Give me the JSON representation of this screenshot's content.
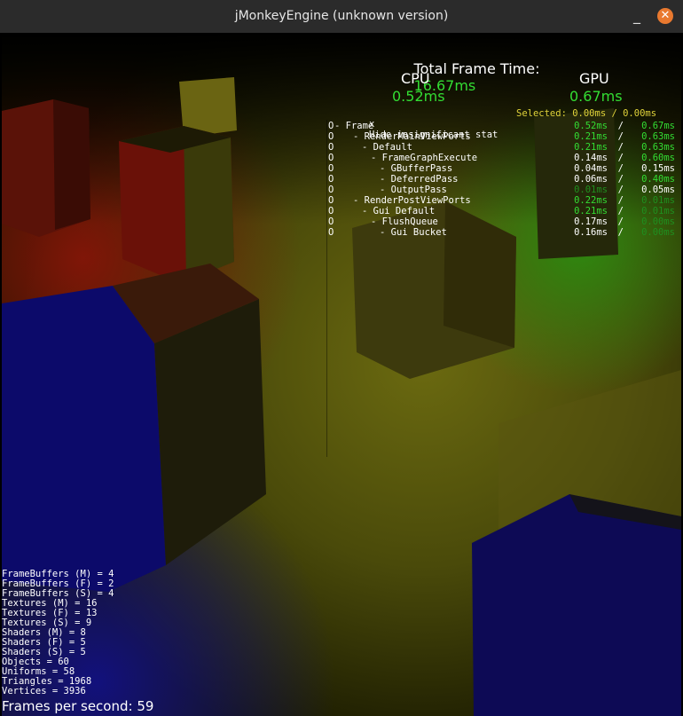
{
  "window": {
    "title": "jMonkeyEngine (unknown version)",
    "minimize_glyph": "_",
    "close_glyph": "✕"
  },
  "profiler": {
    "total_label": "Total Frame Time:",
    "total_value": "16.67ms",
    "cpu_label": "CPU",
    "cpu_value": "0.52ms",
    "gpu_label": "GPU",
    "gpu_value": "0.67ms",
    "hide_label": "Hide insignificant stat",
    "hide_glyph": "x",
    "selected_label": "Selected: 0.00ms / 0.00ms",
    "rows": [
      {
        "toggle": "O",
        "label": "- Frame",
        "cpu": "0.52ms",
        "sep": "/",
        "gpu": "0.67ms"
      },
      {
        "toggle": "O",
        "label": "- RenderMainViewPorts",
        "cpu": "0.21ms",
        "sep": "/",
        "gpu": "0.63ms"
      },
      {
        "toggle": "O",
        "label": "- Default",
        "cpu": "0.21ms",
        "sep": "/",
        "gpu": "0.63ms"
      },
      {
        "toggle": "O",
        "label": "- FrameGraphExecute",
        "cpu": "0.14ms",
        "sep": "/",
        "gpu": "0.60ms"
      },
      {
        "toggle": "O",
        "label": "- GBufferPass",
        "cpu": "0.04ms",
        "sep": "/",
        "gpu": "0.15ms"
      },
      {
        "toggle": "O",
        "label": "- DeferredPass",
        "cpu": "0.06ms",
        "sep": "/",
        "gpu": "0.40ms"
      },
      {
        "toggle": "O",
        "label": "- OutputPass",
        "cpu": "0.01ms",
        "sep": "/",
        "gpu": "0.05ms"
      },
      {
        "toggle": "O",
        "label": "- RenderPostViewPorts",
        "cpu": "0.22ms",
        "sep": "/",
        "gpu": "0.01ms"
      },
      {
        "toggle": "O",
        "label": "- Gui Default",
        "cpu": "0.21ms",
        "sep": "/",
        "gpu": "0.01ms"
      },
      {
        "toggle": "O",
        "label": "- FlushQueue",
        "cpu": "0.17ms",
        "sep": "/",
        "gpu": "0.00ms"
      },
      {
        "toggle": "O",
        "label": "- Gui Bucket",
        "cpu": "0.16ms",
        "sep": "/",
        "gpu": "0.00ms"
      }
    ]
  },
  "stats": [
    "FrameBuffers (M) = 4",
    "FrameBuffers (F) = 2",
    "FrameBuffers (S) = 4",
    "Textures (M) = 16",
    "Textures (F) = 13",
    "Textures (S) = 9",
    "Shaders (M) = 8",
    "Shaders (F) = 5",
    "Shaders (S) = 5",
    "Objects = 60",
    "Uniforms = 58",
    "Triangles = 1968",
    "Vertices = 3936"
  ],
  "fps_text": "Frames per second: 59",
  "colors": {
    "accent_green": "#33dd33",
    "selected_yellow": "#e0d33a",
    "close_orange": "#e9792f",
    "titlebar": "#2b2b2b"
  }
}
